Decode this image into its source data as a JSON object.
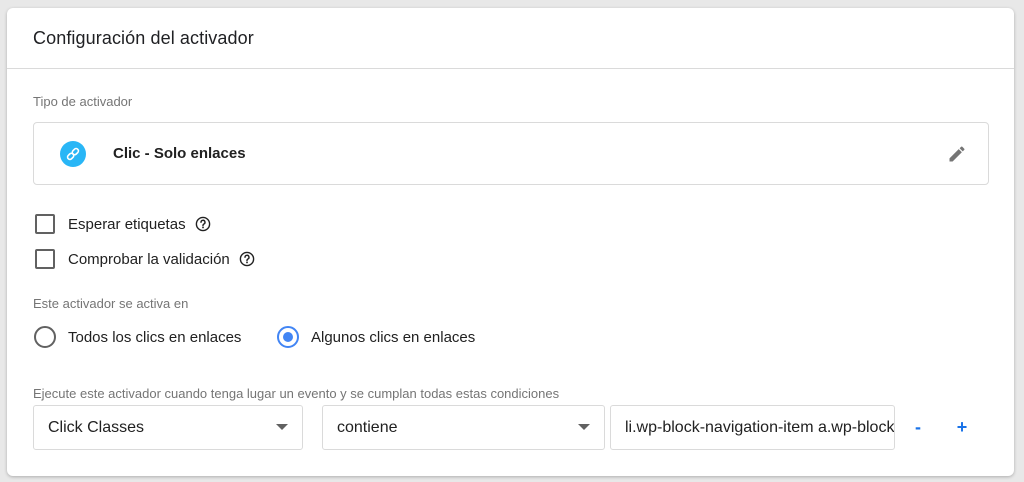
{
  "header": {
    "title": "Configuración del activador"
  },
  "trigger_type": {
    "section_label": "Tipo de activador",
    "name": "Clic - Solo enlaces",
    "icon": "link-icon",
    "icon_color": "#29b6f6"
  },
  "options": [
    {
      "label": "Esperar etiquetas",
      "checked": false
    },
    {
      "label": "Comprobar la validación",
      "checked": false
    }
  ],
  "fires_on": {
    "section_label": "Este activador se activa en",
    "choices": [
      {
        "label": "Todos los clics en enlaces",
        "selected": false
      },
      {
        "label": "Algunos clics en enlaces",
        "selected": true
      }
    ]
  },
  "conditions": {
    "section_label": "Ejecute este activador cuando tenga lugar un evento y se cumplan todas estas condiciones",
    "variable": "Click Classes",
    "operator": "contiene",
    "value": "li.wp-block-navigation-item a.wp-block-navigation-item__content",
    "remove_label": "-",
    "add_label": "+"
  },
  "accent_color": "#4285f4"
}
